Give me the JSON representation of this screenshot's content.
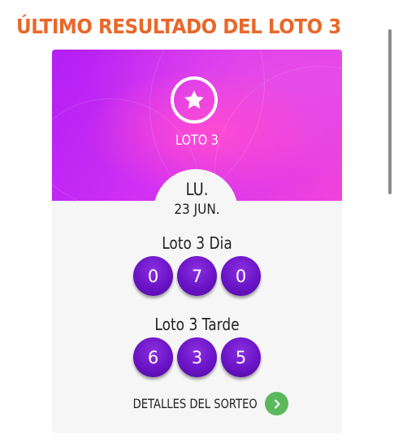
{
  "page": {
    "title": "ÚLTIMO RESULTADO DEL LOTO 3",
    "title_color": "#e8682a"
  },
  "card": {
    "game_icon": "star-icon",
    "game_name": "LOTO 3",
    "header_colors": [
      "#b21ff5",
      "#f044da"
    ],
    "day": "LU.",
    "date": "23 JUN.",
    "draws": [
      {
        "name": "Loto 3 Dia",
        "numbers": [
          "0",
          "7",
          "0"
        ]
      },
      {
        "name": "Loto 3 Tarde",
        "numbers": [
          "6",
          "3",
          "5"
        ]
      }
    ],
    "ball_color": "#6a14c6",
    "details_label": "DETALLES DEL SORTEO",
    "details_icon": "chevron-right-icon",
    "details_icon_color": "#5cb85c"
  }
}
